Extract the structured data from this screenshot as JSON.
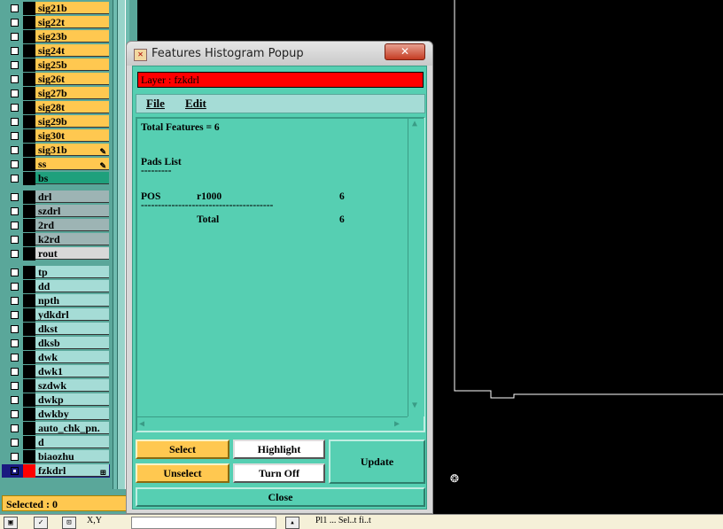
{
  "layers_group1": [
    {
      "name": "sig21b",
      "bg": "#ffc850"
    },
    {
      "name": "sig22t",
      "bg": "#ffc850"
    },
    {
      "name": "sig23b",
      "bg": "#ffc850"
    },
    {
      "name": "sig24t",
      "bg": "#ffc850"
    },
    {
      "name": "sig25b",
      "bg": "#ffc850"
    },
    {
      "name": "sig26t",
      "bg": "#ffc850"
    },
    {
      "name": "sig27b",
      "bg": "#ffc850"
    },
    {
      "name": "sig28t",
      "bg": "#ffc850"
    },
    {
      "name": "sig29b",
      "bg": "#ffc850"
    },
    {
      "name": "sig30t",
      "bg": "#ffc850"
    },
    {
      "name": "sig31b",
      "bg": "#ffc850",
      "mark": "pencil-icon"
    },
    {
      "name": "ss",
      "bg": "#ffc850",
      "mark": "pencil-icon"
    },
    {
      "name": "bs",
      "bg": "#1fa07c"
    }
  ],
  "layers_group2": [
    {
      "name": "drl",
      "bg": "#9db4b4"
    },
    {
      "name": "szdrl",
      "bg": "#9db4b4"
    },
    {
      "name": "2rd",
      "bg": "#9db4b4"
    },
    {
      "name": "k2rd",
      "bg": "#9db4b4"
    },
    {
      "name": "rout",
      "bg": "#d8d8d8"
    }
  ],
  "layers_group3": [
    {
      "name": "tp",
      "bg": "#a5dcd6"
    },
    {
      "name": "dd",
      "bg": "#a5dcd6"
    },
    {
      "name": "npth",
      "bg": "#a5dcd6"
    },
    {
      "name": "ydkdrl",
      "bg": "#a5dcd6"
    },
    {
      "name": "dkst",
      "bg": "#a5dcd6"
    },
    {
      "name": "dksb",
      "bg": "#a5dcd6"
    },
    {
      "name": "dwk",
      "bg": "#a5dcd6"
    },
    {
      "name": "dwk1",
      "bg": "#a5dcd6"
    },
    {
      "name": "szdwk",
      "bg": "#a5dcd6"
    },
    {
      "name": "dwkp",
      "bg": "#a5dcd6"
    },
    {
      "name": "dwkby",
      "bg": "#a5dcd6"
    },
    {
      "name": "auto_chk_pn.",
      "bg": "#a5dcd6"
    },
    {
      "name": "d",
      "bg": "#a5dcd6"
    },
    {
      "name": "biaozhu",
      "bg": "#a5dcd6"
    },
    {
      "name": "fzkdrl",
      "bg": "#a5dcd6",
      "active": true
    }
  ],
  "selected_label": "Selected : 0",
  "popup": {
    "title": "Features Histogram Popup",
    "close_label": "✕",
    "layer_label": "Layer :  fzkdrl",
    "menu": {
      "file": "File",
      "edit": "Edit"
    },
    "report": {
      "total_line": "Total Features = 6",
      "section": "Pads List",
      "underline": "---------",
      "row_type": "POS",
      "row_symbol": "r1000",
      "row_count": "6",
      "divider": "---------------------------------------",
      "total_label": "Total",
      "total_count": "6"
    },
    "buttons": {
      "select": "Select",
      "highlight": "Highlight",
      "update": "Update",
      "unselect": "Unselect",
      "turn_off": "Turn Off",
      "close": "Close"
    }
  },
  "bottom_bar": {
    "coord_label": "X,Y",
    "status": "Pl1 ... Sel..t fi..t"
  },
  "colors": {
    "accent_teal": "#56cfb2",
    "accent_orange": "#ffc850",
    "active_layer_red": "#ff0000"
  }
}
